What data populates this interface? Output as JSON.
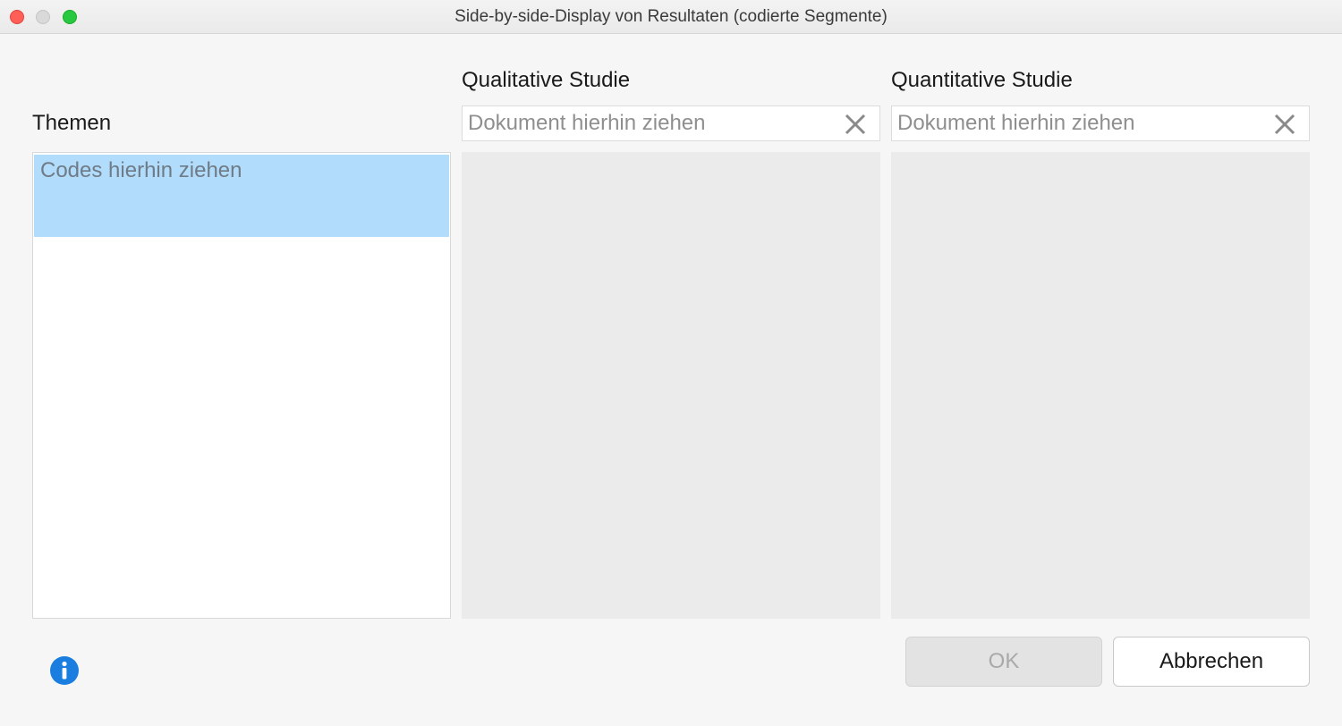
{
  "window": {
    "title": "Side-by-side-Display von Resultaten (codierte Segmente)"
  },
  "themen": {
    "label": "Themen",
    "drop_hint": "Codes hierhin ziehen"
  },
  "studies": [
    {
      "label": "Qualitative Studie",
      "placeholder": "Dokument hierhin ziehen"
    },
    {
      "label": "Quantitative Studie",
      "placeholder": "Dokument hierhin ziehen"
    }
  ],
  "buttons": {
    "ok": "OK",
    "cancel": "Abbrechen"
  },
  "icons": {
    "info": "info-icon",
    "clear": "clear-x-icon"
  },
  "colors": {
    "selection": "#b1dcfb",
    "info_blue": "#1a7ee0",
    "panel_gray": "#ebebeb"
  }
}
